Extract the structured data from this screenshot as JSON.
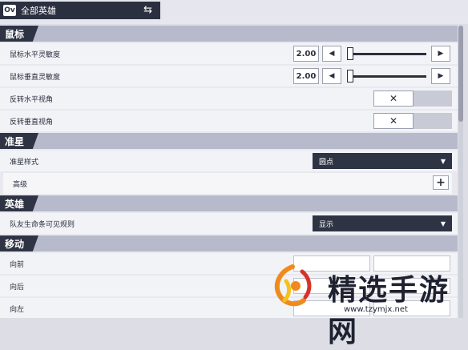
{
  "hero_selector": {
    "logo": "Ov",
    "label": "全部英雄",
    "swap_icon": "⇆"
  },
  "sections": {
    "mouse": {
      "title": "鼠标",
      "horizontal_sensitivity": {
        "label": "鼠标水平灵敏度",
        "value": "2.00"
      },
      "vertical_sensitivity": {
        "label": "鼠标垂直灵敏度",
        "value": "2.00"
      },
      "invert_horizontal": {
        "label": "反转水平视角",
        "toggle": "✕"
      },
      "invert_vertical": {
        "label": "反转垂直视角",
        "toggle": "✕"
      }
    },
    "crosshair": {
      "title": "准星",
      "style": {
        "label": "准星样式",
        "value": "圆点"
      },
      "advanced": {
        "label": "高级",
        "button": "+"
      }
    },
    "hero": {
      "title": "英雄",
      "ally_health_bars": {
        "label": "队友生命条可见规则",
        "value": "显示"
      }
    },
    "movement": {
      "title": "移动",
      "forward": {
        "label": "向前"
      },
      "backward": {
        "label": "向后"
      },
      "left": {
        "label": "向左"
      }
    }
  },
  "arrows": {
    "left": "◀",
    "right": "▶",
    "caret": "▼"
  },
  "watermark": {
    "text": "精选手游网",
    "url": "www.tzymjx.net"
  },
  "colors": {
    "header_dark": "#2f3444",
    "section_bar": "#b7bacb",
    "row_bg": "#f2f3f7"
  }
}
